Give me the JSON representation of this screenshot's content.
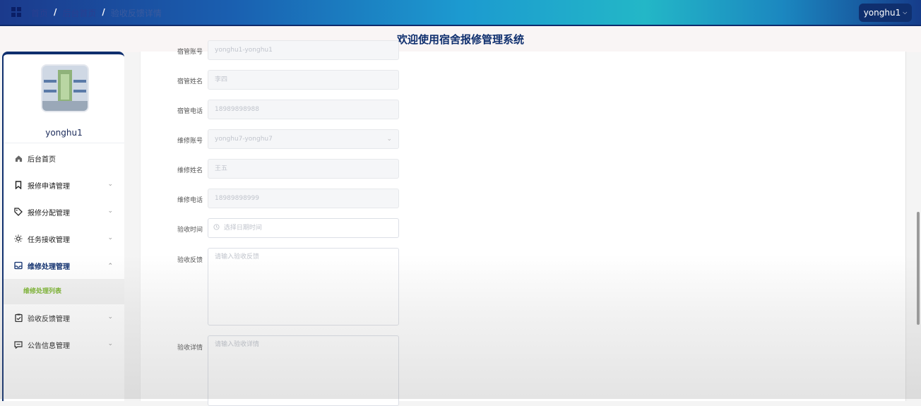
{
  "breadcrumb": {
    "items": [
      "首页",
      "后台首页",
      "验收反馈详情"
    ],
    "separator": "/"
  },
  "user_menu": {
    "label": "yonghu1"
  },
  "page_title": "欢迎使用宿舍报修管理系统",
  "sidebar": {
    "username": "yonghu1",
    "items": [
      {
        "label": "后台首页",
        "icon": "home-icon"
      },
      {
        "label": "报修申请管理",
        "icon": "bookmark-icon"
      },
      {
        "label": "报修分配管理",
        "icon": "tag-icon"
      },
      {
        "label": "任务接收管理",
        "icon": "sun-icon"
      },
      {
        "label": "维修处理管理",
        "icon": "inbox-icon"
      },
      {
        "label": "验收反馈管理",
        "icon": "clipboard-check-icon"
      },
      {
        "label": "公告信息管理",
        "icon": "message-icon"
      }
    ],
    "submenu": "维修处理列表"
  },
  "form": {
    "fields": [
      {
        "label": "宿管账号",
        "value": "yonghu1-yonghu1"
      },
      {
        "label": "宿管姓名",
        "value": "李四"
      },
      {
        "label": "宿管电话",
        "value": "18989898988"
      },
      {
        "label": "维修账号",
        "value": "yonghu7-yonghu7"
      },
      {
        "label": "维修姓名",
        "value": "王五"
      },
      {
        "label": "维修电话",
        "value": "18989898999"
      },
      {
        "label": "验收时间",
        "placeholder": "选择日期时间"
      },
      {
        "label": "验收反馈",
        "placeholder": "请输入验收反馈"
      },
      {
        "label": "验收详情",
        "placeholder": "请输入验收详情"
      }
    ]
  },
  "colors": {
    "accent": "#0f2f6e",
    "submenu": "#7ab32e"
  }
}
